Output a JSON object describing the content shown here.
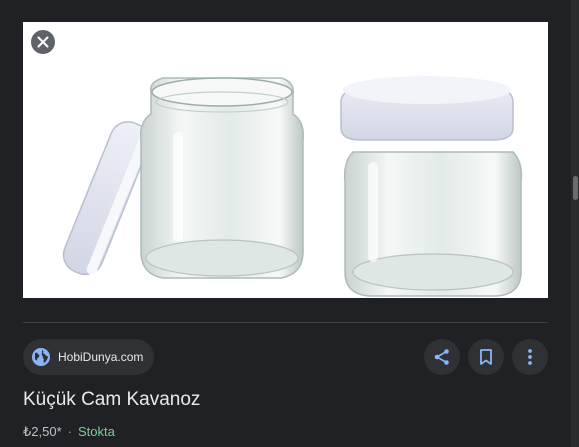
{
  "product": {
    "image_alt_icon": "close-icon",
    "source": {
      "name": "HobiDunya.com",
      "icon": "globe-icon"
    },
    "actions": [
      {
        "name": "share-button",
        "icon": "share-icon"
      },
      {
        "name": "save-button",
        "icon": "bookmark-icon"
      },
      {
        "name": "more-options-button",
        "icon": "more-vert-icon"
      }
    ],
    "title": "Küçük Cam Kavanoz",
    "price": "₺2,50*",
    "separator": "·",
    "stock_status": "Stokta"
  },
  "colors": {
    "background": "#202124",
    "accent_icon": "#8ab4f8",
    "stock_green": "#81c995"
  }
}
